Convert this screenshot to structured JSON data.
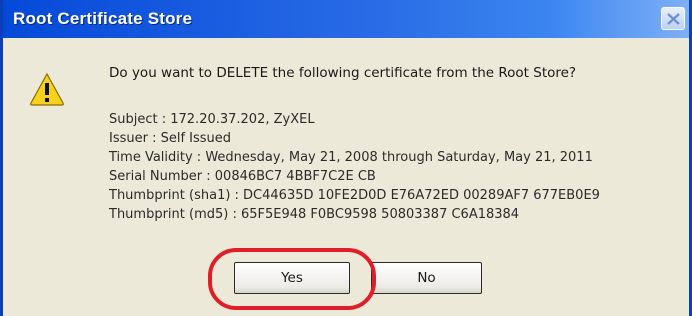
{
  "window": {
    "title": "Root Certificate Store",
    "close_icon": "close-icon"
  },
  "message": {
    "icon": "warning-icon",
    "question": "Do you want to DELETE the following certificate from the Root Store?"
  },
  "certificate": {
    "subject": "Subject : 172.20.37.202, ZyXEL",
    "issuer": "Issuer : Self Issued",
    "validity": "Time Validity : Wednesday, May 21, 2008 through Saturday, May 21, 2011",
    "serial": "Serial Number : 00846BC7 4BBF7C2E CB",
    "thumb_sha1": "Thumbprint (sha1) : DC44635D 10FE2D0D E76A72ED 00289AF7 677EB0E9",
    "thumb_md5": "Thumbprint (md5) : 65F5E948 F0BC9598 50803387 C6A18384"
  },
  "buttons": {
    "yes": "Yes",
    "no": "No"
  },
  "annotation": {
    "color": "#e11d2a",
    "target": "yes-button"
  }
}
